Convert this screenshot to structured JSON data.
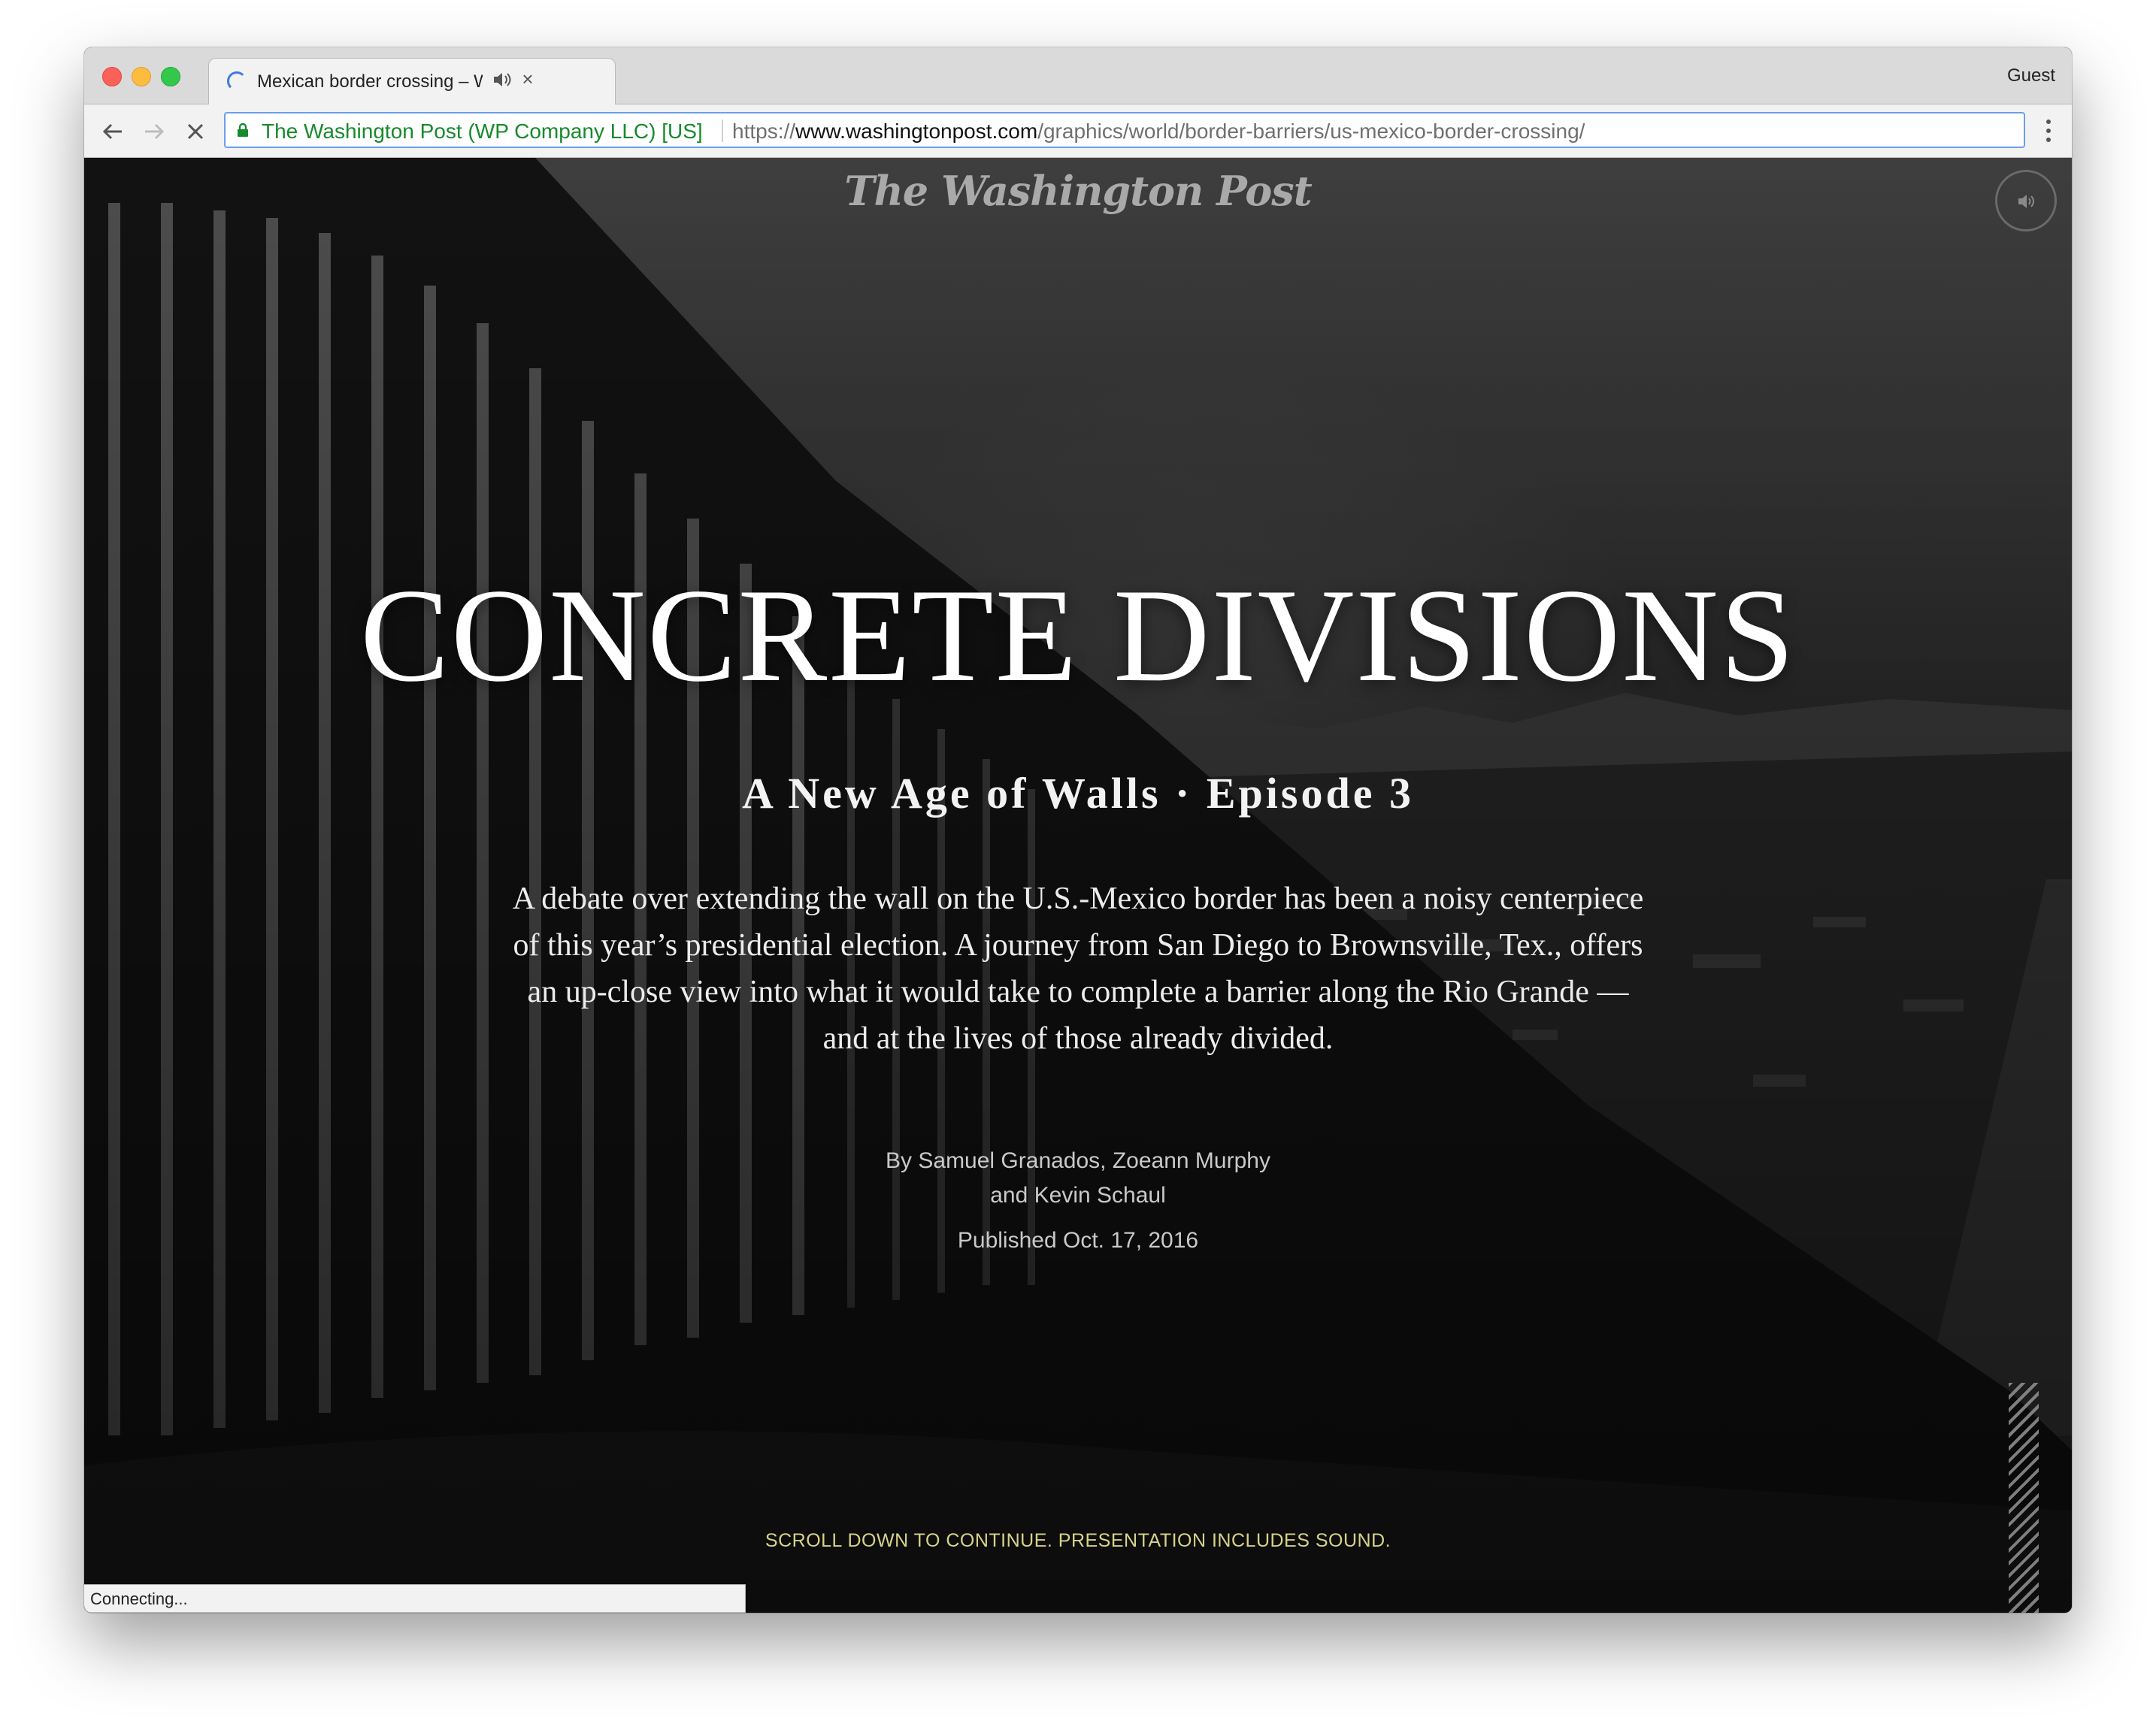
{
  "browser": {
    "tab_title": "Mexican border crossing – W",
    "profile_label": "Guest",
    "security_label": "The Washington Post (WP Company LLC) [US]",
    "url_scheme": "https://",
    "url_host": "www.washingtonpost.com",
    "url_path": "/graphics/world/border-barriers/us-mexico-border-crossing/",
    "status_text": "Connecting..."
  },
  "page": {
    "logo_text": "The Washington Post",
    "headline": "CONCRETE DIVISIONS",
    "subhead": "A New Age of Walls · Episode 3",
    "dek": "A debate over extending the wall on the U.S.-Mexico border has been a noisy centerpiece  of this year’s presidential election. A journey from San Diego to Brownsville, Tex., offers an up-close view into what it would take to complete a barrier along the Rio Grande — and at the lives of those already divided.",
    "byline_line1": "By Samuel Granados, Zoeann Murphy",
    "byline_line2": "and Kevin Schaul",
    "published": "Published Oct. 17, 2016",
    "scroll_cue": "SCROLL DOWN TO CONTINUE. PRESENTATION INCLUDES SOUND."
  },
  "icons": {
    "tab_loading": "loading-spinner-icon",
    "tab_audio": "speaker-icon",
    "tab_close": "close-icon",
    "back": "arrow-left-icon",
    "forward": "arrow-right-icon",
    "stop": "stop-x-icon",
    "lock": "lock-icon",
    "menu": "more-vertical-icon",
    "sound_toggle": "speaker-icon"
  },
  "colors": {
    "secure_green": "#168a2c",
    "omnibox_focus": "#6b9fe9",
    "scroll_cue": "#d6d38a"
  }
}
